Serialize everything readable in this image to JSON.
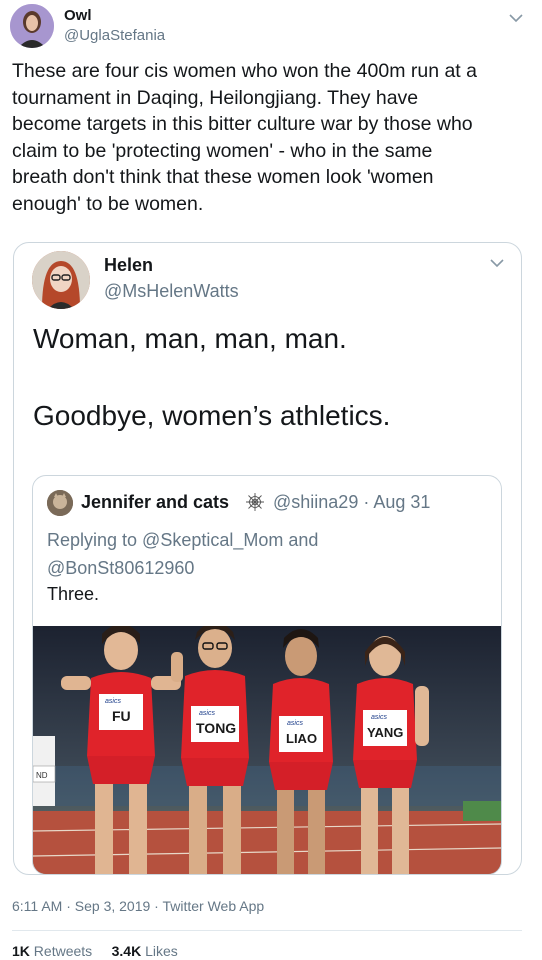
{
  "tweet": {
    "author_name": "Owl",
    "author_handle": "@UglaStefania",
    "text": "These are four cis women who won the 400m run at a\ntournament in Daqing, Heilongjiang. They have\nbecome targets in this bitter culture war by those who\nclaim to be 'protecting women' - who in the same\nbreath don't think that these women look 'women\nenough' to be women.",
    "timestamp": "6:11 AM · Sep 3, 2019 · Twitter Web App",
    "retweets_count": "1K",
    "retweets_label": "Retweets",
    "likes_count": "3.4K",
    "likes_label": "Likes"
  },
  "quoted": {
    "author_name": "Helen",
    "author_handle": "@MsHelenWatts",
    "line1": "Woman, man, man, man.",
    "line2": "Goodbye, women’s athletics."
  },
  "nested": {
    "author_name": "Jennifer and cats",
    "author_handle_date": "@shiina29 · Aug 31",
    "reply_line1": "Replying to @Skeptical_Mom and",
    "reply_line2": "@BonSt80612960",
    "text": "Three.",
    "photo_bibs": [
      "FU",
      "TONG",
      "LIAO",
      "YANG"
    ],
    "photo_brand": "asics",
    "photo_side_bib": "ND"
  },
  "icons": {
    "caret": "chevron-down-icon",
    "spider_web": "spider-web-icon"
  },
  "colors": {
    "text": "#14171a",
    "secondary": "#657786",
    "border": "#ccd6dd",
    "uniform_red": "#e0232a"
  }
}
